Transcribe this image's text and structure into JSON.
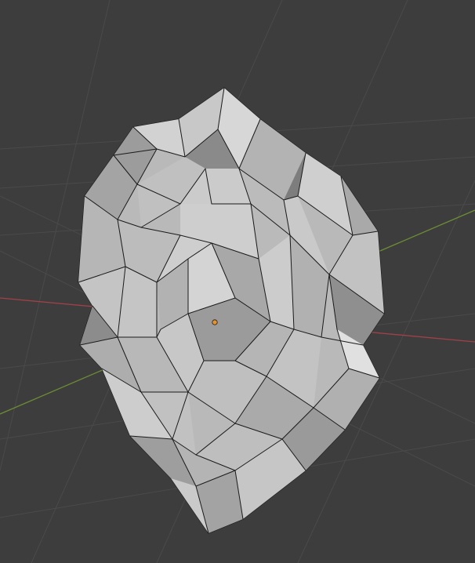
{
  "viewport": {
    "type": "3d-viewport",
    "background": "#3d3d3d",
    "grid_color": "#4a4a4a",
    "x_axis_color": "#a0414a",
    "y_axis_color": "#6c8d33"
  },
  "object": {
    "kind": "low-poly mesh",
    "shading": "solid",
    "base_color": "#bdbdbd",
    "wire_color": "#1a1a1a",
    "origin_color": "#e8922c"
  }
}
